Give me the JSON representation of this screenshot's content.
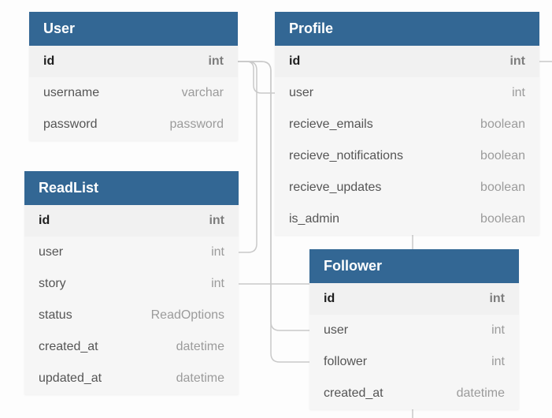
{
  "tables": {
    "user": {
      "title": "User",
      "fields": [
        {
          "name": "id",
          "type": "int"
        },
        {
          "name": "username",
          "type": "varchar"
        },
        {
          "name": "password",
          "type": "password"
        }
      ]
    },
    "profile": {
      "title": "Profile",
      "fields": [
        {
          "name": "id",
          "type": "int"
        },
        {
          "name": "user",
          "type": "int"
        },
        {
          "name": "recieve_emails",
          "type": "boolean"
        },
        {
          "name": "recieve_notifications",
          "type": "boolean"
        },
        {
          "name": "recieve_updates",
          "type": "boolean"
        },
        {
          "name": "is_admin",
          "type": "boolean"
        }
      ]
    },
    "readlist": {
      "title": "ReadList",
      "fields": [
        {
          "name": "id",
          "type": "int"
        },
        {
          "name": "user",
          "type": "int"
        },
        {
          "name": "story",
          "type": "int"
        },
        {
          "name": "status",
          "type": "ReadOptions"
        },
        {
          "name": "created_at",
          "type": "datetime"
        },
        {
          "name": "updated_at",
          "type": "datetime"
        }
      ]
    },
    "follower": {
      "title": "Follower",
      "fields": [
        {
          "name": "id",
          "type": "int"
        },
        {
          "name": "user",
          "type": "int"
        },
        {
          "name": "follower",
          "type": "int"
        },
        {
          "name": "created_at",
          "type": "datetime"
        }
      ]
    }
  }
}
